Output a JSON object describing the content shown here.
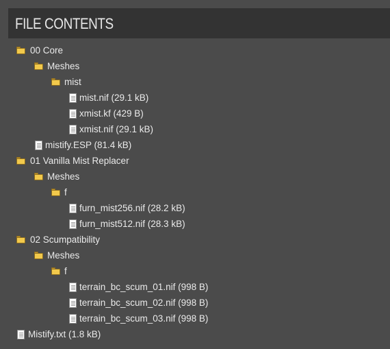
{
  "header": {
    "title": "FILE CONTENTS"
  },
  "tree": [
    {
      "type": "folder",
      "depth": 0,
      "label": "00 Core",
      "icon": "folder-icon"
    },
    {
      "type": "folder",
      "depth": 1,
      "label": "Meshes",
      "icon": "folder-icon"
    },
    {
      "type": "folder",
      "depth": 2,
      "label": "mist",
      "icon": "folder-icon"
    },
    {
      "type": "file",
      "depth": 3,
      "label": "mist.nif (29.1 kB)",
      "icon": "file-icon"
    },
    {
      "type": "file",
      "depth": 3,
      "label": "xmist.kf (429 B)",
      "icon": "file-icon"
    },
    {
      "type": "file",
      "depth": 3,
      "label": "xmist.nif (29.1 kB)",
      "icon": "file-icon"
    },
    {
      "type": "file",
      "depth": 1,
      "label": "mistify.ESP (81.4 kB)",
      "icon": "file-icon"
    },
    {
      "type": "folder",
      "depth": 0,
      "label": "01 Vanilla Mist Replacer",
      "icon": "folder-icon"
    },
    {
      "type": "folder",
      "depth": 1,
      "label": "Meshes",
      "icon": "folder-icon"
    },
    {
      "type": "folder",
      "depth": 2,
      "label": "f",
      "icon": "folder-icon"
    },
    {
      "type": "file",
      "depth": 3,
      "label": "furn_mist256.nif (28.2 kB)",
      "icon": "file-icon"
    },
    {
      "type": "file",
      "depth": 3,
      "label": "furn_mist512.nif (28.3 kB)",
      "icon": "file-icon"
    },
    {
      "type": "folder",
      "depth": 0,
      "label": "02 Scumpatibility",
      "icon": "folder-icon"
    },
    {
      "type": "folder",
      "depth": 1,
      "label": "Meshes",
      "icon": "folder-icon"
    },
    {
      "type": "folder",
      "depth": 2,
      "label": "f",
      "icon": "folder-icon"
    },
    {
      "type": "file",
      "depth": 3,
      "label": "terrain_bc_scum_01.nif (998 B)",
      "icon": "file-icon"
    },
    {
      "type": "file",
      "depth": 3,
      "label": "terrain_bc_scum_02.nif (998 B)",
      "icon": "file-icon"
    },
    {
      "type": "file",
      "depth": 3,
      "label": "terrain_bc_scum_03.nif (998 B)",
      "icon": "file-icon"
    },
    {
      "type": "file",
      "depth": 0,
      "label": "Mistify.txt (1.8 kB)",
      "icon": "file-icon"
    }
  ],
  "colors": {
    "background": "#4b4b4b",
    "header_background": "#333333",
    "text": "#eaeaea",
    "folder": "#f2c94c"
  }
}
